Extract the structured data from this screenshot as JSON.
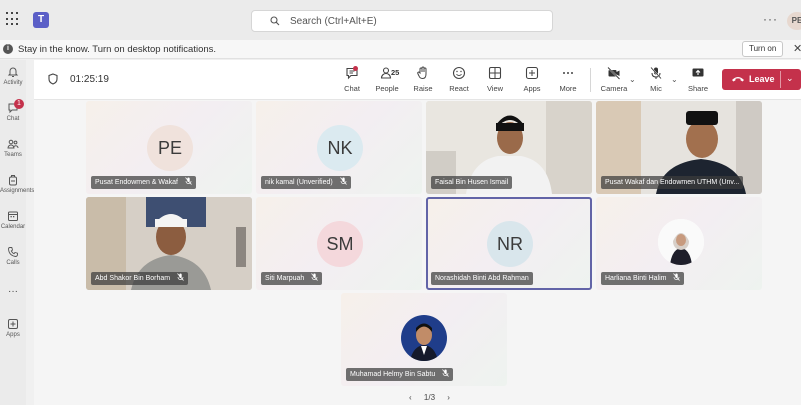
{
  "app": {
    "logo_letter": "T",
    "search_placeholder": "Search (Ctrl+Alt+E)",
    "more": "···",
    "me_initials": "PE"
  },
  "notification": {
    "text": "Stay in the know. Turn on desktop notifications.",
    "button": "Turn on",
    "close": "✕"
  },
  "rail": [
    {
      "label": "Activity",
      "icon": "bell-icon"
    },
    {
      "label": "Chat",
      "icon": "chat-icon",
      "badge": "1"
    },
    {
      "label": "Teams",
      "icon": "teams-icon"
    },
    {
      "label": "Assignments",
      "icon": "backpack-icon"
    },
    {
      "label": "Calendar",
      "icon": "calendar-icon"
    },
    {
      "label": "Calls",
      "icon": "phone-icon"
    },
    {
      "label": "···",
      "icon": "more-icon"
    },
    {
      "label": "Apps",
      "icon": "add-app-icon"
    }
  ],
  "meeting": {
    "timer": "01:25:19",
    "toolbar": {
      "chat": "Chat",
      "people": "People",
      "people_count": "25",
      "raise": "Raise",
      "react": "React",
      "view": "View",
      "apps": "Apps",
      "more": "More",
      "camera": "Camera",
      "mic": "Mic",
      "share": "Share",
      "leave": "Leave"
    }
  },
  "participants": [
    {
      "name": "Pusat Endowmen & Wakaf",
      "initials": "PE",
      "type": "avatar",
      "color": "#f0e2dc"
    },
    {
      "name": "nik kamal (Unverified)",
      "initials": "NK",
      "type": "avatar",
      "color": "#dbeaf0"
    },
    {
      "name": "Faisal Bin Husen Ismail",
      "type": "video"
    },
    {
      "name": "Pusat Wakaf dan Endowmen UTHM (Unv...",
      "type": "video"
    },
    {
      "name": "Abd Shakor Bin Borham",
      "type": "video"
    },
    {
      "name": "Siti Marpuah",
      "initials": "SM",
      "type": "avatar",
      "color": "#f4d8dc"
    },
    {
      "name": "Norashidah Binti Abd Rahman",
      "initials": "NR",
      "type": "avatar",
      "color": "#d9e6ec",
      "selected": true
    },
    {
      "name": "Harliana Binti Halim",
      "type": "photo"
    },
    {
      "name": "Muhamad Helmy Bin Sabtu",
      "type": "photo"
    }
  ],
  "pager": {
    "label": "1/3",
    "prev": "‹",
    "next": "›"
  },
  "colors": {
    "brand": "#5b5fc7",
    "leave": "#c4314b",
    "selection": "#6264a7"
  }
}
